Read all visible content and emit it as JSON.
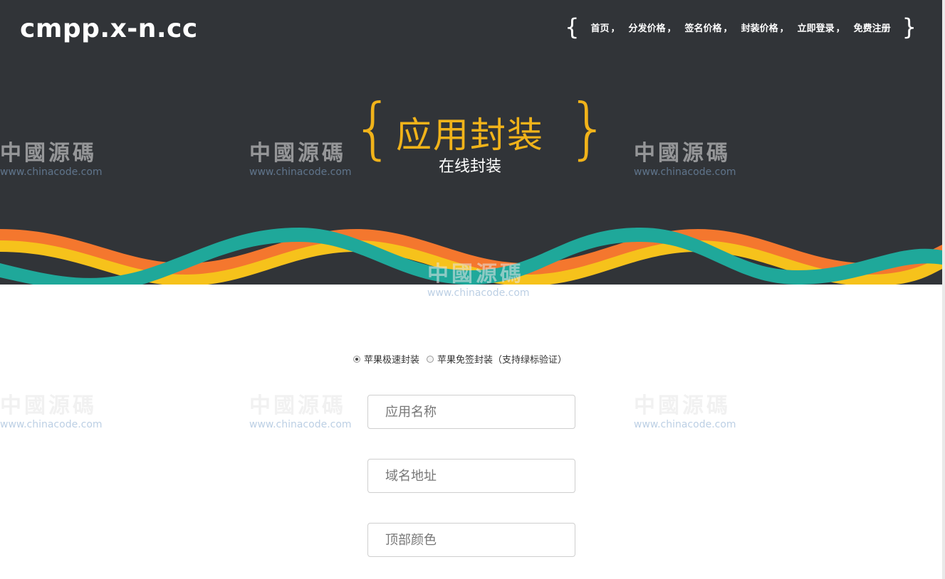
{
  "site": {
    "logo": "cmpp.x-n.cc"
  },
  "nav": {
    "open_brace": "{",
    "close_brace": "}",
    "items": [
      {
        "label": "首页",
        "sep": "，"
      },
      {
        "label": "分发价格",
        "sep": "，"
      },
      {
        "label": "签名价格",
        "sep": "，"
      },
      {
        "label": "封装价格",
        "sep": "，"
      },
      {
        "label": "立即登录",
        "sep": "，"
      },
      {
        "label": "免费注册",
        "sep": ""
      }
    ]
  },
  "hero": {
    "title": "应用封装",
    "subtitle": "在线封装",
    "brace_left": "{",
    "brace_right": "}"
  },
  "watermark": {
    "cn": "中國源碼",
    "url": "www.chinacode.com"
  },
  "form": {
    "options": [
      {
        "label": "苹果极速封装",
        "checked": true
      },
      {
        "label": "苹果免签封装（支持绿标验证）",
        "checked": false
      }
    ],
    "fields": [
      {
        "placeholder": "应用名称"
      },
      {
        "placeholder": "域名地址"
      },
      {
        "placeholder": "顶部颜色"
      }
    ]
  },
  "colors": {
    "header_bg": "#313438",
    "accent_gold": "#f1b31a",
    "wave_teal": "#1fa89a",
    "wave_yellow": "#f6c21b",
    "wave_orange": "#f4772e"
  }
}
